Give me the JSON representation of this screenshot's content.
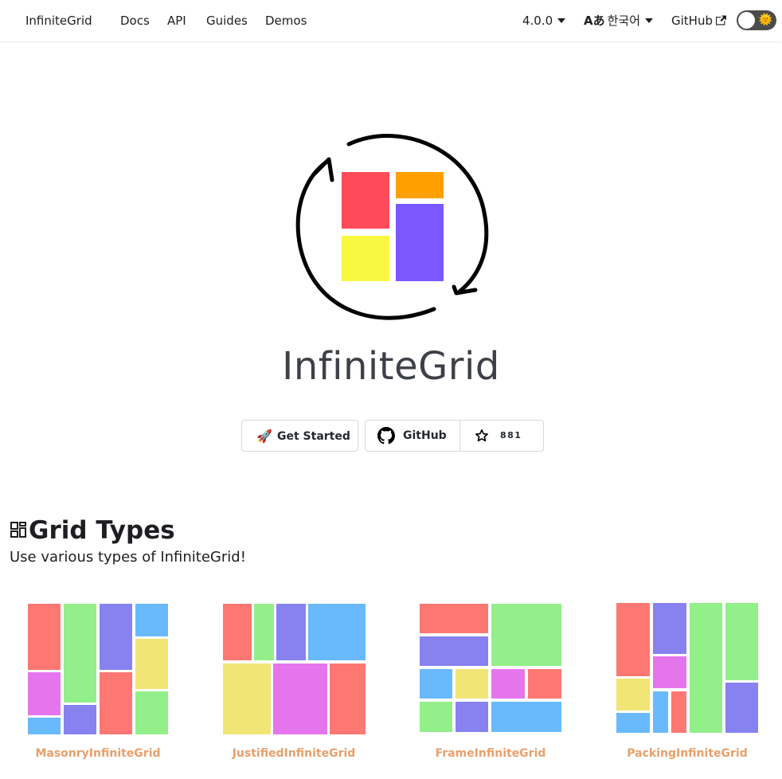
{
  "nav": {
    "brand": "InfiniteGrid",
    "links": [
      "Docs",
      "API",
      "Guides",
      "Demos"
    ],
    "version": "4.0.0",
    "language_icon": "Aあ",
    "language": "한국어",
    "github": "GitHub",
    "theme_toggle_icon": "sun-icon"
  },
  "hero": {
    "title": "InfiniteGrid",
    "get_started_label": "Get Started",
    "get_started_icon": "🚀",
    "github_label": "GitHub",
    "star_count": "881"
  },
  "colors": {
    "red": "#ff4a5a",
    "orange": "#ffa000",
    "yellow": "#f8f840",
    "purple": "#7b57ff",
    "tile_red": "#fd7773",
    "tile_green": "#93ef8a",
    "tile_purple": "#8782f0",
    "tile_blue": "#69bafd",
    "tile_yellow": "#f1e576",
    "tile_magenta": "#e575ed",
    "link_orange": "#e8a06a"
  },
  "section": {
    "icon": "grid-icon",
    "title": "Grid Types",
    "subtitle": "Use various types of InfiniteGrid!"
  },
  "grid_types": [
    {
      "label": "MasonryInfiniteGrid"
    },
    {
      "label": "JustifiedInfiniteGrid"
    },
    {
      "label": "FrameInfiniteGrid"
    },
    {
      "label": "PackingInfiniteGrid"
    }
  ]
}
